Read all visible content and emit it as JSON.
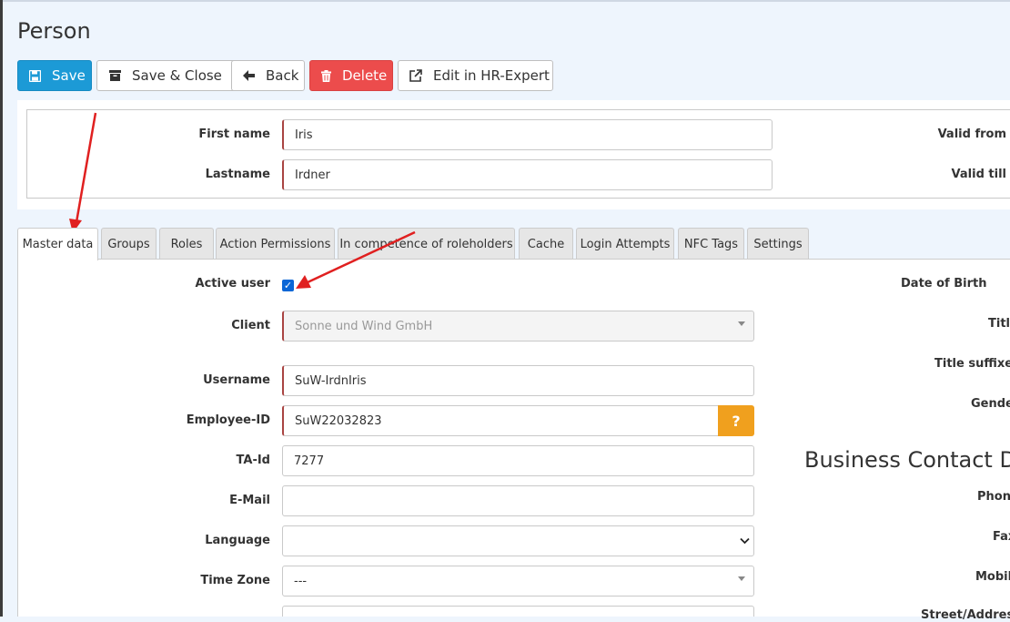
{
  "page": {
    "title": "Person"
  },
  "toolbar": {
    "save": "Save",
    "save_close": "Save & Close",
    "back": "Back",
    "delete": "Delete",
    "edit_hr": "Edit in HR-Expert"
  },
  "header": {
    "first_name_label": "First name",
    "first_name_value": "Iris",
    "lastname_label": "Lastname",
    "lastname_value": "Irdner",
    "valid_from_label": "Valid from",
    "valid_till_label": "Valid till"
  },
  "tabs": [
    {
      "label": "Master data",
      "active": true
    },
    {
      "label": "Groups"
    },
    {
      "label": "Roles"
    },
    {
      "label": "Action Permissions"
    },
    {
      "label": "In competence of roleholders"
    },
    {
      "label": "Cache"
    },
    {
      "label": "Login Attempts"
    },
    {
      "label": "NFC Tags"
    },
    {
      "label": "Settings"
    }
  ],
  "form": {
    "active_user_label": "Active user",
    "active_user_checked": true,
    "client_label": "Client",
    "client_value": "Sonne und Wind GmbH",
    "username_label": "Username",
    "username_value": "SuW-IrdnIris",
    "employee_id_label": "Employee-ID",
    "employee_id_value": "SuW22032823",
    "help_button": "?",
    "ta_id_label": "TA-Id",
    "ta_id_value": "7277",
    "email_label": "E-Mail",
    "email_value": "",
    "language_label": "Language",
    "language_value": "",
    "timezone_label": "Time Zone",
    "timezone_value": "---"
  },
  "right": {
    "date_of_birth_label": "Date of Birth",
    "title_label": "Title",
    "title_suffixed_label": "Title suffixed",
    "gender_label": "Gender",
    "section_title": "Business Contact D",
    "phone_label": "Phone",
    "fax_label": "Fax",
    "mobile_label": "Mobile",
    "street_label": "Street/Address"
  },
  "colors": {
    "primary": "#1c9ad6",
    "danger": "#ec4c4c",
    "warning": "#f0a01e",
    "required_border": "#a94442",
    "annotation_arrow": "#e02020"
  }
}
